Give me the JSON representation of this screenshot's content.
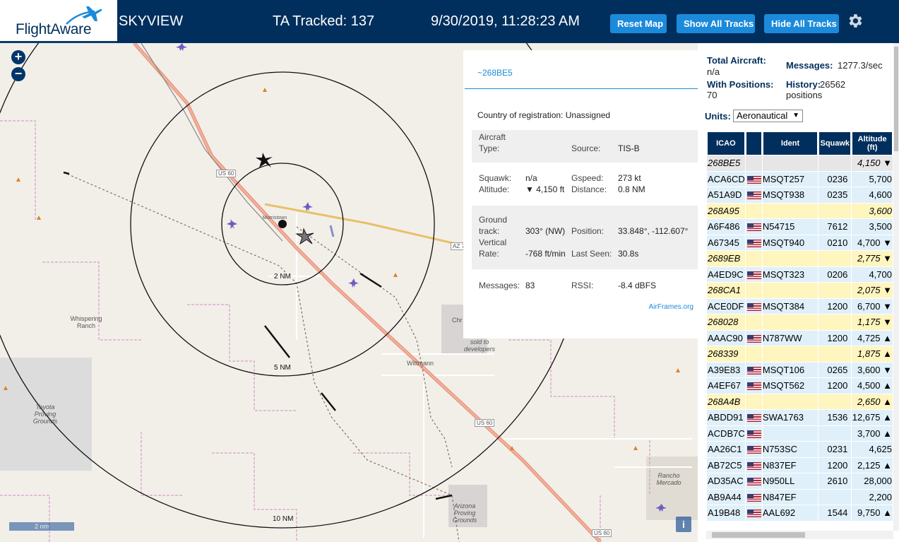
{
  "header": {
    "logo_text": "FlightAware",
    "site_name": "SKYVIEW",
    "ta_tracked": "TA Tracked: 137",
    "timestamp": "9/30/2019, 11:28:23 AM",
    "reset_map": "Reset Map",
    "show_all_tracks": "Show All Tracks",
    "hide_all_tracks": "Hide All Tracks",
    "settings_icon": "gear-icon"
  },
  "map": {
    "zoom_in": "+",
    "zoom_out": "−",
    "ring_labels": [
      "2 NM",
      "5 NM",
      "10 NM"
    ],
    "place_labels": {
      "whispering_ranch": "Whispering Ranch",
      "wittmann": "Wittmann",
      "toyota": "Toyota Proving Grounds",
      "arizona": "Arizona Proving Grounds",
      "rancho": "Rancho Mercado",
      "sold": "sold to developers",
      "chr": "Chr",
      "morristown": "Morristown"
    },
    "road_labels": [
      "US 60",
      "US 60",
      "US 60",
      "AZ 7"
    ],
    "scale": "2 nm",
    "info_button": "i"
  },
  "selected_aircraft": {
    "icao": "~268BE5",
    "country_label": "Country of registration:",
    "country": "Unassigned",
    "aircraft_type_label": "Aircraft Type:",
    "aircraft_type": "",
    "source_label": "Source:",
    "source": "TIS-B",
    "squawk_label": "Squawk:",
    "squawk": "n/a",
    "altitude_label": "Altitude:",
    "altitude": "▼ 4,150 ft",
    "gspeed_label": "Gspeed:",
    "gspeed": "273 kt",
    "distance_label": "Distance:",
    "distance": "0.8 NM",
    "ground_track_label": "Ground track:",
    "ground_track": "303° (NW)",
    "position_label": "Position:",
    "position": "33.848°, -112.607°",
    "vertical_rate_label": "Vertical Rate:",
    "vertical_rate": "-768 ft/min",
    "last_seen_label": "Last Seen:",
    "last_seen": "30.8s",
    "messages_label": "Messages:",
    "messages": "83",
    "rssi_label": "RSSI:",
    "rssi": "-8.4 dBFS",
    "airframes_link": "AirFrames.org"
  },
  "sidebar": {
    "total_aircraft_label": "Total Aircraft:",
    "total_aircraft": "n/a",
    "messages_label": "Messages:",
    "messages": "1277.3/sec",
    "with_positions_label": "With Positions:",
    "with_positions": "70",
    "history_label": "History:",
    "history": "26562 positions",
    "units_label": "Units:",
    "units_value": "Aeronautical",
    "columns": [
      "ICAO",
      "",
      "Ident",
      "Squawk",
      "Altitude (ft)"
    ],
    "rows": [
      {
        "icao": "268BE5",
        "flag": false,
        "ident": "",
        "squawk": "",
        "alt": "4,150 ▼",
        "kind": "selected"
      },
      {
        "icao": "ACA6CD",
        "flag": true,
        "ident": "MSQT257",
        "squawk": "0236",
        "alt": "5,700",
        "kind": "normal"
      },
      {
        "icao": "A51A9D",
        "flag": true,
        "ident": "MSQT938",
        "squawk": "0235",
        "alt": "4,600",
        "kind": "normal"
      },
      {
        "icao": "268A95",
        "flag": false,
        "ident": "",
        "squawk": "",
        "alt": "3,600",
        "kind": "tisb"
      },
      {
        "icao": "A6F486",
        "flag": true,
        "ident": "N54715",
        "squawk": "7612",
        "alt": "3,500",
        "kind": "normal"
      },
      {
        "icao": "A67345",
        "flag": true,
        "ident": "MSQT940",
        "squawk": "0210",
        "alt": "4,700 ▼",
        "kind": "normal"
      },
      {
        "icao": "2689EB",
        "flag": false,
        "ident": "",
        "squawk": "",
        "alt": "2,775 ▼",
        "kind": "tisb"
      },
      {
        "icao": "A4ED9C",
        "flag": true,
        "ident": "MSQT323",
        "squawk": "0206",
        "alt": "4,700",
        "kind": "normal"
      },
      {
        "icao": "268CA1",
        "flag": false,
        "ident": "",
        "squawk": "",
        "alt": "2,075 ▼",
        "kind": "tisb"
      },
      {
        "icao": "ACE0DF",
        "flag": true,
        "ident": "MSQT384",
        "squawk": "1200",
        "alt": "6,700 ▼",
        "kind": "normal"
      },
      {
        "icao": "268028",
        "flag": false,
        "ident": "",
        "squawk": "",
        "alt": "1,175 ▼",
        "kind": "tisb"
      },
      {
        "icao": "AAAC90",
        "flag": true,
        "ident": "N787WW",
        "squawk": "1200",
        "alt": "4,725 ▲",
        "kind": "normal"
      },
      {
        "icao": "268339",
        "flag": false,
        "ident": "",
        "squawk": "",
        "alt": "1,875 ▲",
        "kind": "tisb"
      },
      {
        "icao": "A39E83",
        "flag": true,
        "ident": "MSQT106",
        "squawk": "0265",
        "alt": "3,600 ▼",
        "kind": "normal"
      },
      {
        "icao": "A4EF67",
        "flag": true,
        "ident": "MSQT562",
        "squawk": "1200",
        "alt": "4,500 ▲",
        "kind": "normal"
      },
      {
        "icao": "268A4B",
        "flag": false,
        "ident": "",
        "squawk": "",
        "alt": "2,650 ▲",
        "kind": "tisb"
      },
      {
        "icao": "ABDD91",
        "flag": true,
        "ident": "SWA1763",
        "squawk": "1536",
        "alt": "12,675 ▲",
        "kind": "normal"
      },
      {
        "icao": "ACDB7C",
        "flag": true,
        "ident": "",
        "squawk": "",
        "alt": "3,700 ▲",
        "kind": "normal"
      },
      {
        "icao": "AA26C1",
        "flag": true,
        "ident": "N753SC",
        "squawk": "0231",
        "alt": "4,625",
        "kind": "normal"
      },
      {
        "icao": "AB72C5",
        "flag": true,
        "ident": "N837EF",
        "squawk": "1200",
        "alt": "2,125 ▲",
        "kind": "normal"
      },
      {
        "icao": "AD35AC",
        "flag": true,
        "ident": "N950LL",
        "squawk": "2610",
        "alt": "28,000",
        "kind": "normal"
      },
      {
        "icao": "AB9A44",
        "flag": true,
        "ident": "N847EF",
        "squawk": "",
        "alt": "2,200",
        "kind": "normal"
      },
      {
        "icao": "A19B48",
        "flag": true,
        "ident": "AAL692",
        "squawk": "1544",
        "alt": "9,750 ▲",
        "kind": "normal"
      }
    ]
  }
}
